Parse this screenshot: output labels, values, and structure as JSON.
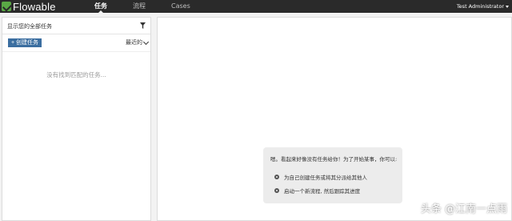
{
  "app": {
    "brand": "Flowable",
    "accent_color": "#5aa845",
    "topbar_color": "#2a2a2a"
  },
  "nav": {
    "tasks": "任务",
    "processes": "流程",
    "cases": "Cases"
  },
  "user": {
    "name": "Test Administrator"
  },
  "task_panel": {
    "filter_label": "显示您的全部任务",
    "filter_icon": "filter-icon",
    "create_button": "+ 创建任务",
    "sort_label": "最近的",
    "empty_message": "没有找到匹配的任务..."
  },
  "help": {
    "intro": "嗯。看起来好像没有任务给你！为了开始某事，你可以:",
    "items": [
      "为自己创建任务或将其分派给其他人",
      "启动一个新流程, 然后跟踪其进度"
    ]
  },
  "watermark": "头条 @江南一点雨"
}
